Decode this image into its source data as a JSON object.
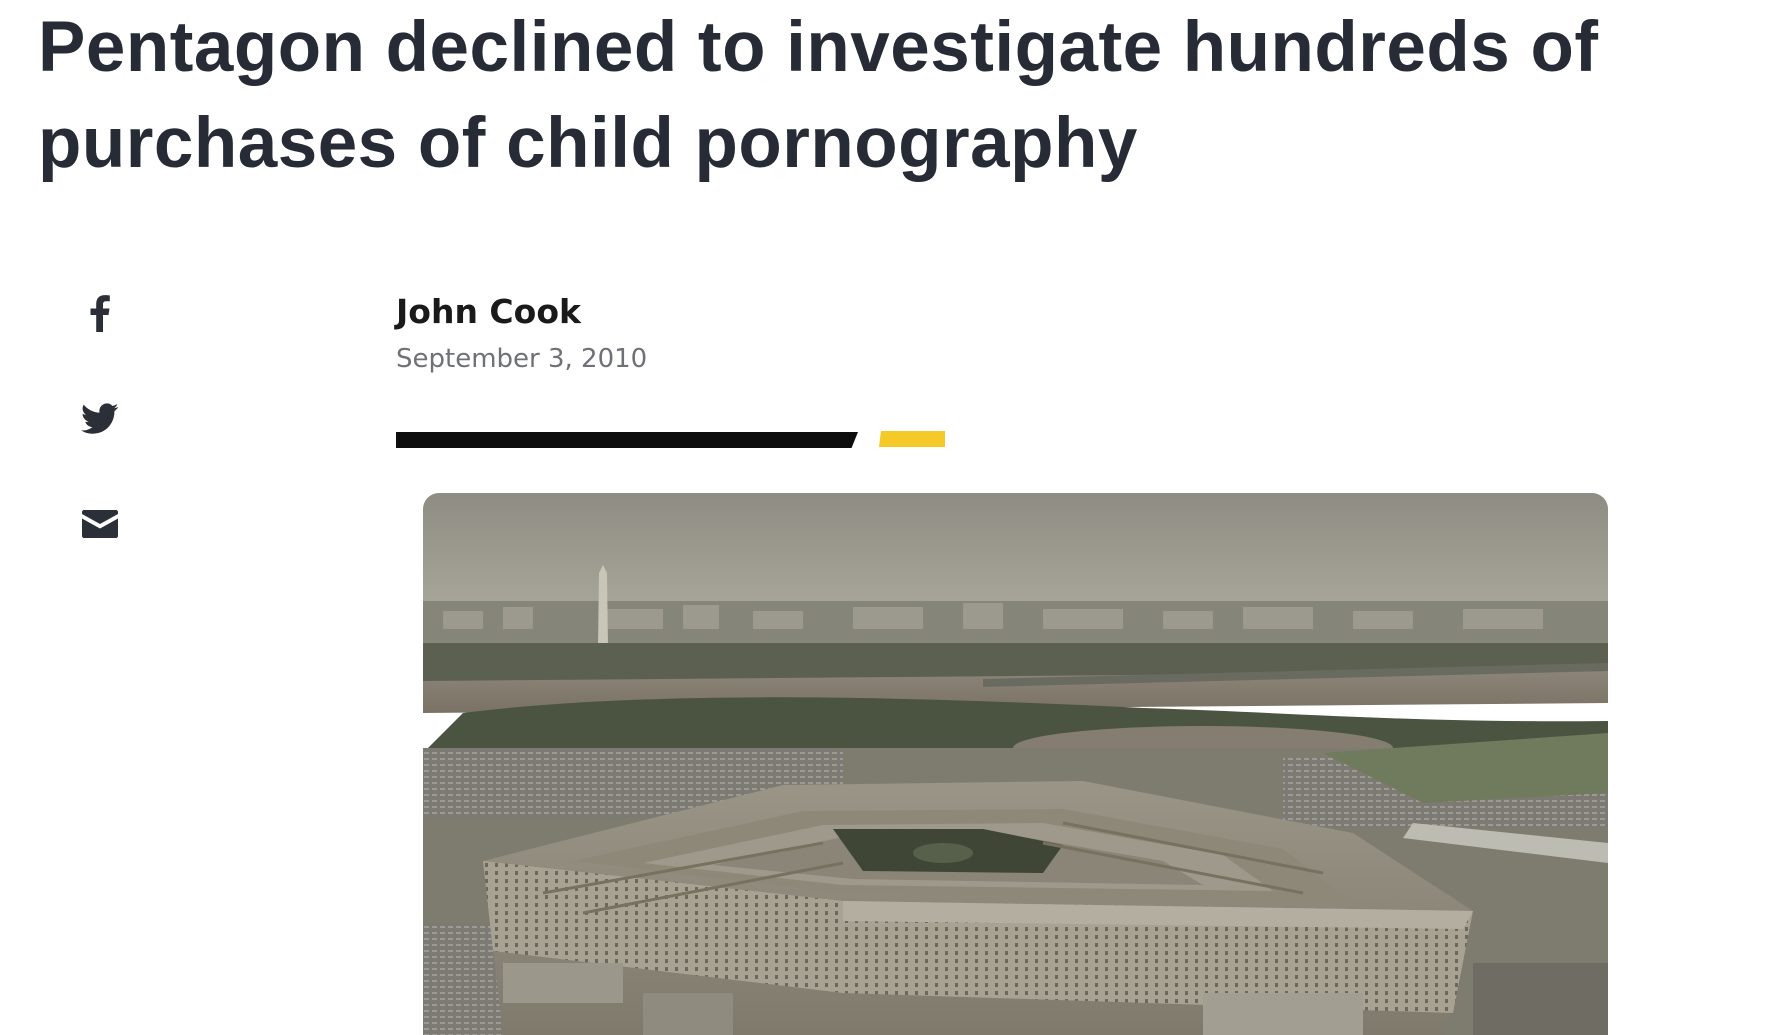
{
  "article": {
    "headline_line1": "Pentagon declined to investigate hundreds of",
    "headline_line2": "purchases of child pornography",
    "author": "John Cook",
    "date": "September 3, 2010"
  },
  "share": {
    "items": [
      {
        "icon": "facebook-icon"
      },
      {
        "icon": "twitter-icon"
      },
      {
        "icon": "email-icon"
      }
    ]
  },
  "colors": {
    "headline": "#262b35",
    "accent_black": "#0d0d0d",
    "accent_yellow": "#f4c928",
    "icon": "#2b2f38",
    "date": "#6f7177"
  },
  "hero_image": {
    "subject": "aerial-pentagon-photo"
  }
}
